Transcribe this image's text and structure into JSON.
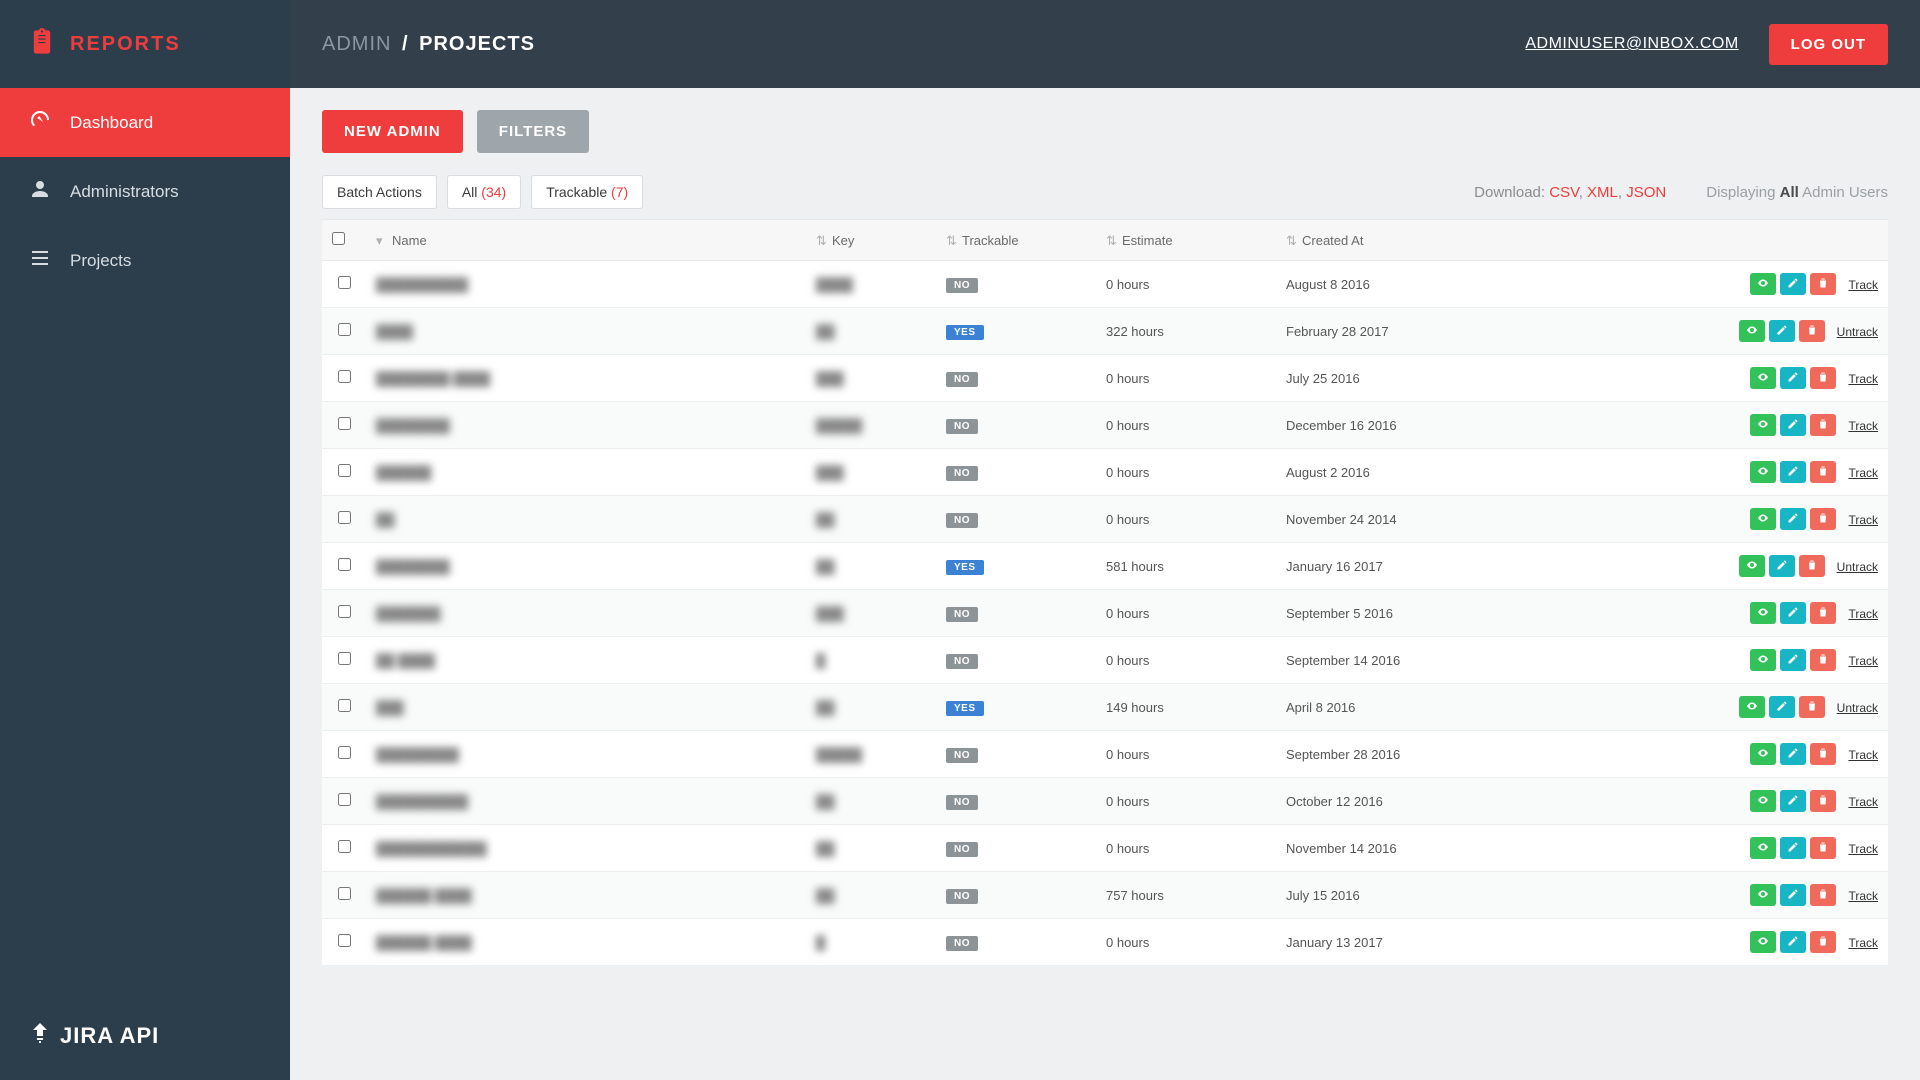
{
  "brand": "REPORTS",
  "footer_brand": "JIRA API",
  "breadcrumb": {
    "admin": "ADMIN",
    "sep": "/",
    "page": "PROJECTS"
  },
  "user_email": "ADMINUSER@INBOX.COM",
  "logout": "LOG OUT",
  "nav": {
    "dashboard": "Dashboard",
    "administrators": "Administrators",
    "projects": "Projects"
  },
  "actions": {
    "new_admin": "NEW ADMIN",
    "filters": "FILTERS"
  },
  "chips": {
    "batch": "Batch Actions",
    "all_label": "All",
    "all_count": "(34)",
    "trackable_label": "Trackable",
    "trackable_count": "(7)"
  },
  "download": {
    "label": "Download:",
    "csv": "CSV",
    "xml": "XML",
    "json": "JSON"
  },
  "displaying": {
    "prefix": "Displaying",
    "all": "All",
    "suffix": "Admin Users"
  },
  "columns": {
    "name": "Name",
    "key": "Key",
    "trackable": "Trackable",
    "estimate": "Estimate",
    "created_at": "Created At"
  },
  "badge_text": {
    "yes": "YES",
    "no": "NO"
  },
  "action_labels": {
    "track": "Track",
    "untrack": "Untrack"
  },
  "rows": [
    {
      "name": "██████████",
      "key": "████",
      "trackable": false,
      "estimate": "0 hours",
      "created": "August 8 2016",
      "link": "track"
    },
    {
      "name": "████",
      "key": "██",
      "trackable": true,
      "estimate": "322 hours",
      "created": "February 28 2017",
      "link": "untrack"
    },
    {
      "name": "████████ ████",
      "key": "███",
      "trackable": false,
      "estimate": "0 hours",
      "created": "July 25 2016",
      "link": "track"
    },
    {
      "name": "████████",
      "key": "█████",
      "trackable": false,
      "estimate": "0 hours",
      "created": "December 16 2016",
      "link": "track"
    },
    {
      "name": "██████",
      "key": "███",
      "trackable": false,
      "estimate": "0 hours",
      "created": "August 2 2016",
      "link": "track"
    },
    {
      "name": "██",
      "key": "██",
      "trackable": false,
      "estimate": "0 hours",
      "created": "November 24 2014",
      "link": "track"
    },
    {
      "name": "████████",
      "key": "██",
      "trackable": true,
      "estimate": "581 hours",
      "created": "January 16 2017",
      "link": "untrack"
    },
    {
      "name": "███████",
      "key": "███",
      "trackable": false,
      "estimate": "0 hours",
      "created": "September 5 2016",
      "link": "track"
    },
    {
      "name": "██ ████",
      "key": "█",
      "trackable": false,
      "estimate": "0 hours",
      "created": "September 14 2016",
      "link": "track"
    },
    {
      "name": "███",
      "key": "██",
      "trackable": true,
      "estimate": "149 hours",
      "created": "April 8 2016",
      "link": "untrack"
    },
    {
      "name": "█████████",
      "key": "█████",
      "trackable": false,
      "estimate": "0 hours",
      "created": "September 28 2016",
      "link": "track"
    },
    {
      "name": "██████████",
      "key": "██",
      "trackable": false,
      "estimate": "0 hours",
      "created": "October 12 2016",
      "link": "track"
    },
    {
      "name": "████████████",
      "key": "██",
      "trackable": false,
      "estimate": "0 hours",
      "created": "November 14 2016",
      "link": "track"
    },
    {
      "name": "██████ ████",
      "key": "██",
      "trackable": false,
      "estimate": "757 hours",
      "created": "July 15 2016",
      "link": "track"
    },
    {
      "name": "██████ ████",
      "key": "█",
      "trackable": false,
      "estimate": "0 hours",
      "created": "January 13 2017",
      "link": "track"
    }
  ]
}
